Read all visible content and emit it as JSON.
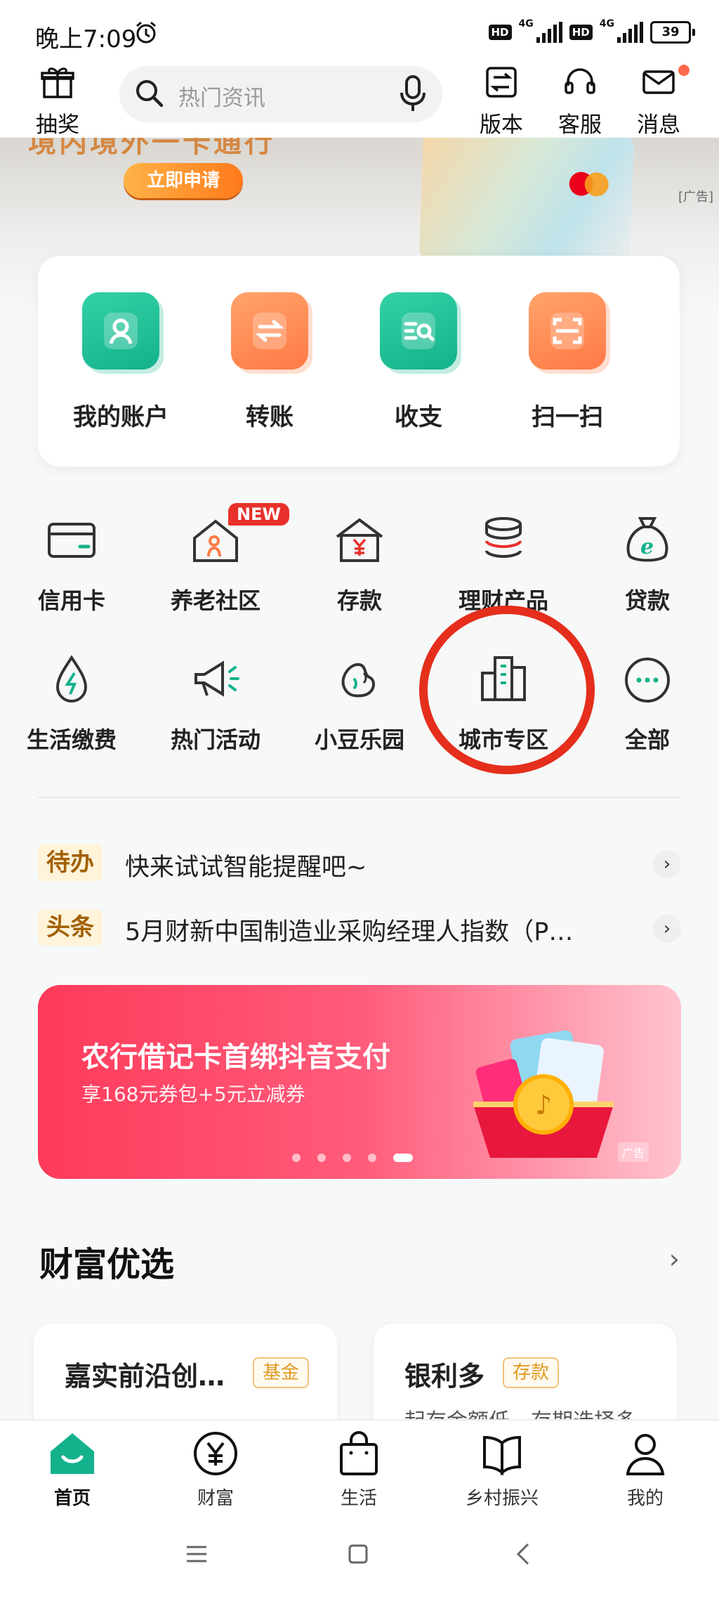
{
  "status_bar": {
    "time": "晚上7:09",
    "hd1": "HD",
    "net1": "4G",
    "hd2": "HD",
    "net2": "4G",
    "battery": "39"
  },
  "header": {
    "lottery_label": "抽奖",
    "search_placeholder": "热门资讯",
    "version_label": "版本",
    "service_label": "客服",
    "message_label": "消息"
  },
  "hero_ad": {
    "headline": "境内境外一卡通行",
    "apply_label": "立即申请",
    "ad_tag": "[广告]"
  },
  "quick_actions": [
    {
      "label": "我的账户",
      "icon": "user-icon",
      "color": "green"
    },
    {
      "label": "转账",
      "icon": "transfer-icon",
      "color": "orange"
    },
    {
      "label": "收支",
      "icon": "bill-search-icon",
      "color": "green"
    },
    {
      "label": "扫一扫",
      "icon": "scan-icon",
      "color": "orange"
    }
  ],
  "services_row1": [
    {
      "label": "信用卡",
      "icon": "credit-card-icon"
    },
    {
      "label": "养老社区",
      "icon": "elderly-home-icon",
      "badge": "NEW"
    },
    {
      "label": "存款",
      "icon": "deposit-house-icon"
    },
    {
      "label": "理财产品",
      "icon": "coin-stack-icon"
    },
    {
      "label": "贷款",
      "icon": "money-bag-icon"
    }
  ],
  "services_row2": [
    {
      "label": "生活缴费",
      "icon": "water-drop-bolt-icon"
    },
    {
      "label": "热门活动",
      "icon": "megaphone-icon"
    },
    {
      "label": "小豆乐园",
      "icon": "bean-icon"
    },
    {
      "label": "城市专区",
      "icon": "city-buildings-icon"
    },
    {
      "label": "全部",
      "icon": "more-dots-icon"
    }
  ],
  "notices": [
    {
      "tag": "待办",
      "text": "快来试试智能提醒吧~"
    },
    {
      "tag": "头条",
      "text": "5月财新中国制造业采购经理人指数（P…"
    }
  ],
  "promo_banner": {
    "title": "农行借记卡首绑抖音支付",
    "subtitle": "享168元券包+5元立减券",
    "ad_tag": "广告",
    "slide_count": 5,
    "active_slide": 5
  },
  "wealth_section": {
    "title": "财富优选",
    "more": "›",
    "products": [
      {
        "name": "嘉实前沿创…",
        "badge": "基金",
        "sub": ""
      },
      {
        "name": "银利多",
        "badge": "存款",
        "sub": "起存金额低　存期选择多"
      }
    ]
  },
  "bottom_nav": [
    {
      "label": "首页",
      "icon": "home-icon",
      "active": true
    },
    {
      "label": "财富",
      "icon": "yuan-circle-icon",
      "active": false
    },
    {
      "label": "生活",
      "icon": "shopping-bag-icon",
      "active": false
    },
    {
      "label": "乡村振兴",
      "icon": "book-icon",
      "active": false
    },
    {
      "label": "我的",
      "icon": "person-icon",
      "active": false
    }
  ],
  "colors": {
    "brand_green": "#14b28c",
    "accent_orange": "#ff7a45",
    "highlight_circle": "#e52e1c",
    "badge_red": "#e8312b"
  }
}
